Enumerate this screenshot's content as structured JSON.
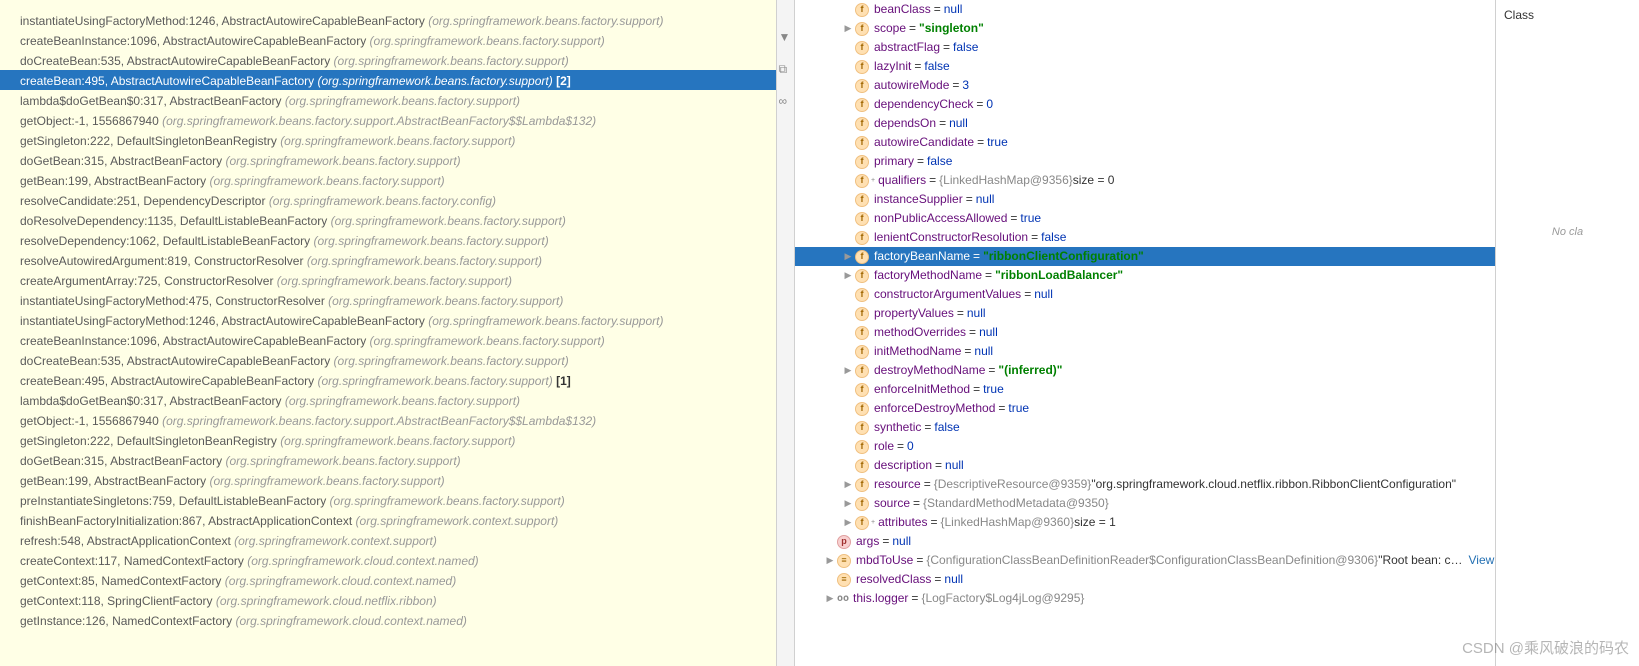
{
  "watermark": "CSDN @乘风破浪的码农",
  "farRight": {
    "header": "Class",
    "empty": "No cla"
  },
  "stack": [
    {
      "m": "instantiateUsingFactoryMethod:1246, AbstractAutowireCapableBeanFactory",
      "p": "(org.springframework.beans.factory.support)",
      "s": ""
    },
    {
      "m": "createBeanInstance:1096, AbstractAutowireCapableBeanFactory",
      "p": "(org.springframework.beans.factory.support)",
      "s": ""
    },
    {
      "m": "doCreateBean:535, AbstractAutowireCapableBeanFactory",
      "p": "(org.springframework.beans.factory.support)",
      "s": ""
    },
    {
      "m": "createBean:495, AbstractAutowireCapableBeanFactory",
      "p": "(org.springframework.beans.factory.support)",
      "s": " [2]",
      "sel": true
    },
    {
      "m": "lambda$doGetBean$0:317, AbstractBeanFactory",
      "p": "(org.springframework.beans.factory.support)",
      "s": ""
    },
    {
      "m": "getObject:-1, 1556867940",
      "p": "(org.springframework.beans.factory.support.AbstractBeanFactory$$Lambda$132)",
      "s": ""
    },
    {
      "m": "getSingleton:222, DefaultSingletonBeanRegistry",
      "p": "(org.springframework.beans.factory.support)",
      "s": ""
    },
    {
      "m": "doGetBean:315, AbstractBeanFactory",
      "p": "(org.springframework.beans.factory.support)",
      "s": ""
    },
    {
      "m": "getBean:199, AbstractBeanFactory",
      "p": "(org.springframework.beans.factory.support)",
      "s": ""
    },
    {
      "m": "resolveCandidate:251, DependencyDescriptor",
      "p": "(org.springframework.beans.factory.config)",
      "s": ""
    },
    {
      "m": "doResolveDependency:1135, DefaultListableBeanFactory",
      "p": "(org.springframework.beans.factory.support)",
      "s": ""
    },
    {
      "m": "resolveDependency:1062, DefaultListableBeanFactory",
      "p": "(org.springframework.beans.factory.support)",
      "s": ""
    },
    {
      "m": "resolveAutowiredArgument:819, ConstructorResolver",
      "p": "(org.springframework.beans.factory.support)",
      "s": ""
    },
    {
      "m": "createArgumentArray:725, ConstructorResolver",
      "p": "(org.springframework.beans.factory.support)",
      "s": ""
    },
    {
      "m": "instantiateUsingFactoryMethod:475, ConstructorResolver",
      "p": "(org.springframework.beans.factory.support)",
      "s": ""
    },
    {
      "m": "instantiateUsingFactoryMethod:1246, AbstractAutowireCapableBeanFactory",
      "p": "(org.springframework.beans.factory.support)",
      "s": ""
    },
    {
      "m": "createBeanInstance:1096, AbstractAutowireCapableBeanFactory",
      "p": "(org.springframework.beans.factory.support)",
      "s": ""
    },
    {
      "m": "doCreateBean:535, AbstractAutowireCapableBeanFactory",
      "p": "(org.springframework.beans.factory.support)",
      "s": ""
    },
    {
      "m": "createBean:495, AbstractAutowireCapableBeanFactory",
      "p": "(org.springframework.beans.factory.support)",
      "s": " [1]"
    },
    {
      "m": "lambda$doGetBean$0:317, AbstractBeanFactory",
      "p": "(org.springframework.beans.factory.support)",
      "s": ""
    },
    {
      "m": "getObject:-1, 1556867940",
      "p": "(org.springframework.beans.factory.support.AbstractBeanFactory$$Lambda$132)",
      "s": ""
    },
    {
      "m": "getSingleton:222, DefaultSingletonBeanRegistry",
      "p": "(org.springframework.beans.factory.support)",
      "s": ""
    },
    {
      "m": "doGetBean:315, AbstractBeanFactory",
      "p": "(org.springframework.beans.factory.support)",
      "s": ""
    },
    {
      "m": "getBean:199, AbstractBeanFactory",
      "p": "(org.springframework.beans.factory.support)",
      "s": ""
    },
    {
      "m": "preInstantiateSingletons:759, DefaultListableBeanFactory",
      "p": "(org.springframework.beans.factory.support)",
      "s": ""
    },
    {
      "m": "finishBeanFactoryInitialization:867, AbstractApplicationContext",
      "p": "(org.springframework.context.support)",
      "s": ""
    },
    {
      "m": "refresh:548, AbstractApplicationContext",
      "p": "(org.springframework.context.support)",
      "s": ""
    },
    {
      "m": "createContext:117, NamedContextFactory",
      "p": "(org.springframework.cloud.context.named)",
      "s": ""
    },
    {
      "m": "getContext:85, NamedContextFactory",
      "p": "(org.springframework.cloud.context.named)",
      "s": ""
    },
    {
      "m": "getContext:118, SpringClientFactory",
      "p": "(org.springframework.cloud.netflix.ribbon)",
      "s": ""
    },
    {
      "m": "getInstance:126, NamedContextFactory",
      "p": "(org.springframework.cloud.context.named)",
      "s": ""
    }
  ],
  "vars": [
    {
      "d": 2,
      "a": "",
      "ic": "f",
      "name": "beanClass",
      "val": "null",
      "vt": "null"
    },
    {
      "d": 2,
      "a": ">",
      "ic": "f",
      "name": "scope",
      "val": "\"singleton\"",
      "vt": "str"
    },
    {
      "d": 2,
      "a": "",
      "ic": "f",
      "name": "abstractFlag",
      "val": "false",
      "vt": "bool"
    },
    {
      "d": 2,
      "a": "",
      "ic": "f",
      "name": "lazyInit",
      "val": "false",
      "vt": "bool"
    },
    {
      "d": 2,
      "a": "",
      "ic": "f",
      "name": "autowireMode",
      "val": "3",
      "vt": "num"
    },
    {
      "d": 2,
      "a": "",
      "ic": "f",
      "name": "dependencyCheck",
      "val": "0",
      "vt": "num"
    },
    {
      "d": 2,
      "a": "",
      "ic": "f",
      "name": "dependsOn",
      "val": "null",
      "vt": "null"
    },
    {
      "d": 2,
      "a": "",
      "ic": "f",
      "name": "autowireCandidate",
      "val": "true",
      "vt": "bool"
    },
    {
      "d": 2,
      "a": "",
      "ic": "f",
      "name": "primary",
      "val": "false",
      "vt": "bool"
    },
    {
      "d": 2,
      "a": "",
      "ic": "f",
      "mod": "+",
      "name": "qualifiers",
      "ref": "{LinkedHashMap@9356}",
      "tail": "  size = 0"
    },
    {
      "d": 2,
      "a": "",
      "ic": "f",
      "name": "instanceSupplier",
      "val": "null",
      "vt": "null"
    },
    {
      "d": 2,
      "a": "",
      "ic": "f",
      "name": "nonPublicAccessAllowed",
      "val": "true",
      "vt": "bool"
    },
    {
      "d": 2,
      "a": "",
      "ic": "f",
      "name": "lenientConstructorResolution",
      "val": "false",
      "vt": "bool"
    },
    {
      "d": 2,
      "a": ">",
      "ic": "f",
      "name": "factoryBeanName",
      "val": "\"ribbonClientConfiguration\"",
      "vt": "str",
      "sel": true
    },
    {
      "d": 2,
      "a": ">",
      "ic": "f",
      "name": "factoryMethodName",
      "val": "\"ribbonLoadBalancer\"",
      "vt": "str"
    },
    {
      "d": 2,
      "a": "",
      "ic": "f",
      "name": "constructorArgumentValues",
      "val": "null",
      "vt": "null"
    },
    {
      "d": 2,
      "a": "",
      "ic": "f",
      "name": "propertyValues",
      "val": "null",
      "vt": "null"
    },
    {
      "d": 2,
      "a": "",
      "ic": "f",
      "name": "methodOverrides",
      "val": "null",
      "vt": "null"
    },
    {
      "d": 2,
      "a": "",
      "ic": "f",
      "name": "initMethodName",
      "val": "null",
      "vt": "null"
    },
    {
      "d": 2,
      "a": ">",
      "ic": "f",
      "name": "destroyMethodName",
      "val": "\"(inferred)\"",
      "vt": "str"
    },
    {
      "d": 2,
      "a": "",
      "ic": "f",
      "name": "enforceInitMethod",
      "val": "true",
      "vt": "bool"
    },
    {
      "d": 2,
      "a": "",
      "ic": "f",
      "name": "enforceDestroyMethod",
      "val": "true",
      "vt": "bool"
    },
    {
      "d": 2,
      "a": "",
      "ic": "f",
      "name": "synthetic",
      "val": "false",
      "vt": "bool"
    },
    {
      "d": 2,
      "a": "",
      "ic": "f",
      "name": "role",
      "val": "0",
      "vt": "num"
    },
    {
      "d": 2,
      "a": "",
      "ic": "f",
      "name": "description",
      "val": "null",
      "vt": "null"
    },
    {
      "d": 2,
      "a": ">",
      "ic": "f",
      "name": "resource",
      "ref": "{DescriptiveResource@9359}",
      "tail": "  \"org.springframework.cloud.netflix.ribbon.RibbonClientConfiguration\""
    },
    {
      "d": 2,
      "a": ">",
      "ic": "f",
      "name": "source",
      "ref": "{StandardMethodMetadata@9350}",
      "tail": ""
    },
    {
      "d": 2,
      "a": ">",
      "ic": "f",
      "mod": "+",
      "name": "attributes",
      "ref": "{LinkedHashMap@9360}",
      "tail": "  size = 1"
    },
    {
      "d": 1,
      "a": "",
      "ic": "p",
      "name": "args",
      "val": "null",
      "vt": "null"
    },
    {
      "d": 1,
      "a": ">",
      "ic": "≡",
      "name": "mbdToUse",
      "ref": "{ConfigurationClassBeanDefinitionReader$ConfigurationClassBeanDefinition@9306}",
      "tail": "  \"Root bean: c…",
      "view": "View"
    },
    {
      "d": 1,
      "a": "",
      "ic": "≡",
      "name": "resolvedClass",
      "val": "null",
      "vt": "null"
    },
    {
      "d": 1,
      "a": ">",
      "ic": "oo",
      "name": "this.logger",
      "ref": "{LogFactory$Log4jLog@9295}",
      "tail": ""
    }
  ]
}
